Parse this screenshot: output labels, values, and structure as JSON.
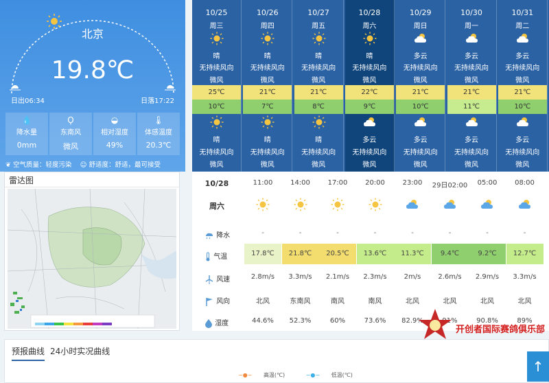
{
  "current": {
    "city": "北京",
    "temperature": "19.8℃",
    "sunrise": "日出06:34",
    "sunset": "日落17:22",
    "stats": [
      {
        "label": "降水量",
        "value": "0mm",
        "icon": "raindrops-icon"
      },
      {
        "label": "东南风",
        "value": "微风",
        "icon": "wind-vane-icon"
      },
      {
        "label": "相对湿度",
        "value": "49%",
        "icon": "humidity-icon"
      },
      {
        "label": "体感温度",
        "value": "20.3℃",
        "icon": "thermometer-icon"
      }
    ],
    "air_quality": "空气质量：轻度污染",
    "comfort": "舒适度：舒适，最可接受"
  },
  "radar": {
    "title": "雷达图"
  },
  "forecast": [
    {
      "date": "10/25",
      "weekday": "周三",
      "day_weather": "晴",
      "day_wind": "无持续风向",
      "day_level": "微风",
      "high": "25℃",
      "low": "10℃",
      "night_weather": "晴",
      "night_wind": "无持续风向",
      "night_level": "微风",
      "day_icon": "sun",
      "night_icon": "sun",
      "selected": false
    },
    {
      "date": "10/26",
      "weekday": "周四",
      "day_weather": "晴",
      "day_wind": "无持续风向",
      "day_level": "微风",
      "high": "21℃",
      "low": "7℃",
      "night_weather": "晴",
      "night_wind": "无持续风向",
      "night_level": "微风",
      "day_icon": "sun",
      "night_icon": "sun",
      "selected": false
    },
    {
      "date": "10/27",
      "weekday": "周五",
      "day_weather": "晴",
      "day_wind": "无持续风向",
      "day_level": "微风",
      "high": "21℃",
      "low": "8℃",
      "night_weather": "晴",
      "night_wind": "无持续风向",
      "night_level": "微风",
      "day_icon": "sun",
      "night_icon": "sun",
      "selected": false
    },
    {
      "date": "10/28",
      "weekday": "周六",
      "day_weather": "晴",
      "day_wind": "无持续风向",
      "day_level": "微风",
      "high": "22℃",
      "low": "9℃",
      "night_weather": "多云",
      "night_wind": "无持续风向",
      "night_level": "微风",
      "day_icon": "sun",
      "night_icon": "cloud",
      "selected": true
    },
    {
      "date": "10/29",
      "weekday": "周日",
      "day_weather": "多云",
      "day_wind": "无持续风向",
      "day_level": "微风",
      "high": "21℃",
      "low": "10℃",
      "night_weather": "多云",
      "night_wind": "无持续风向",
      "night_level": "微风",
      "day_icon": "cloud",
      "night_icon": "cloud",
      "selected": false
    },
    {
      "date": "10/30",
      "weekday": "周一",
      "day_weather": "多云",
      "day_wind": "无持续风向",
      "day_level": "微风",
      "high": "21℃",
      "low": "11℃",
      "night_weather": "多云",
      "night_wind": "无持续风向",
      "night_level": "微风",
      "day_icon": "cloud",
      "night_icon": "cloud",
      "selected": false
    },
    {
      "date": "10/31",
      "weekday": "周二",
      "day_weather": "多云",
      "day_wind": "无持续风向",
      "day_level": "微风",
      "high": "21℃",
      "low": "10℃",
      "night_weather": "多云",
      "night_wind": "无持续风向",
      "night_level": "微风",
      "day_icon": "cloud",
      "night_icon": "cloud",
      "selected": false
    }
  ],
  "hourly": {
    "date": "10/28",
    "weekday": "周六",
    "labels": {
      "precip": "降水",
      "temp": "气温",
      "wind_speed": "风速",
      "wind_dir": "风向",
      "humidity": "湿度"
    },
    "rows": [
      {
        "time": "11:00",
        "icon": "sun",
        "precip": "-",
        "temp": "17.8℃",
        "temp_color": "#e8f3c8",
        "wind_speed": "2.8m/s",
        "wind_dir": "北风",
        "humidity": "44.6%"
      },
      {
        "time": "14:00",
        "icon": "sun",
        "precip": "-",
        "temp": "21.8℃",
        "temp_color": "#f2dd6e",
        "wind_speed": "3.3m/s",
        "wind_dir": "东南风",
        "humidity": "52.3%"
      },
      {
        "time": "17:00",
        "icon": "sun",
        "precip": "-",
        "temp": "20.5℃",
        "temp_color": "#f2dd6e",
        "wind_speed": "2.1m/s",
        "wind_dir": "南风",
        "humidity": "60%"
      },
      {
        "time": "20:00",
        "icon": "sun",
        "precip": "-",
        "temp": "13.6℃",
        "temp_color": "#c5ec8a",
        "wind_speed": "2.3m/s",
        "wind_dir": "南风",
        "humidity": "73.6%"
      },
      {
        "time": "23:00",
        "icon": "cloud",
        "precip": "-",
        "temp": "11.3℃",
        "temp_color": "#c5ec8a",
        "wind_speed": "2m/s",
        "wind_dir": "北风",
        "humidity": "82.9%"
      },
      {
        "time": "29日02:00",
        "icon": "cloud",
        "precip": "-",
        "temp": "9.4℃",
        "temp_color": "#8fcf6e",
        "wind_speed": "2.6m/s",
        "wind_dir": "北风",
        "humidity": "91%"
      },
      {
        "time": "05:00",
        "icon": "cloud",
        "precip": "-",
        "temp": "9.2℃",
        "temp_color": "#8fcf6e",
        "wind_speed": "2.9m/s",
        "wind_dir": "北风",
        "humidity": "90.8%"
      },
      {
        "time": "08:00",
        "icon": "cloud",
        "precip": "-",
        "temp": "12.7℃",
        "temp_color": "#c5ec8a",
        "wind_speed": "3.3m/s",
        "wind_dir": "北风",
        "humidity": "89%"
      }
    ]
  },
  "tabs": [
    {
      "label": "预报曲线",
      "active": true
    },
    {
      "label": "24小时实况曲线",
      "active": false
    }
  ],
  "legend": {
    "high": "高温(℃)",
    "low": "低温(℃)"
  },
  "totop_label": "↑",
  "watermark": "开创者国际赛鸽俱乐部"
}
